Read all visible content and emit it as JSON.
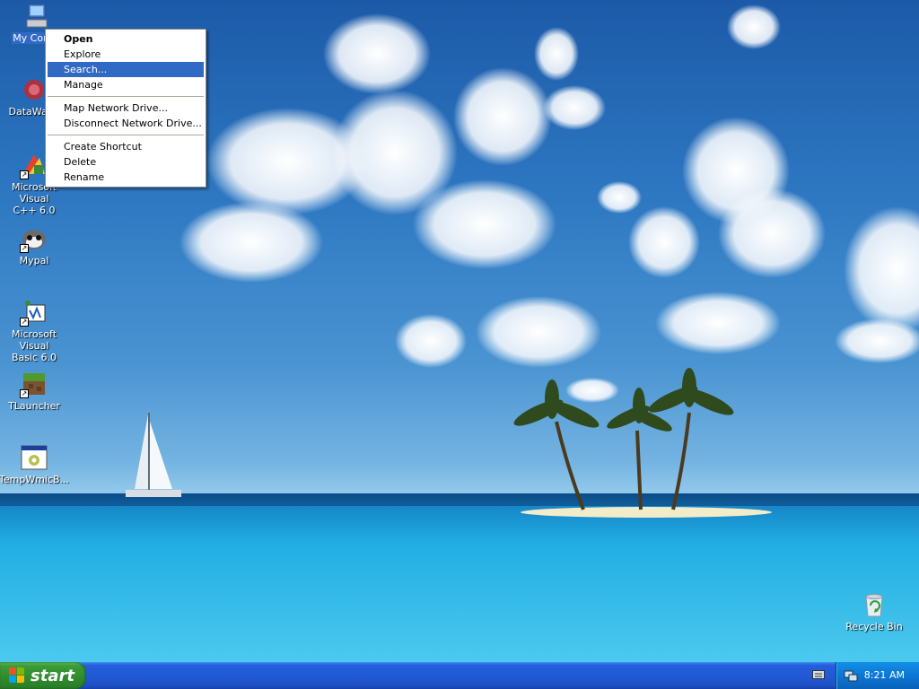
{
  "desktop": {
    "icons": [
      {
        "label": "My Computer",
        "label_visible": "My Comp",
        "icon": "my-computer-icon"
      },
      {
        "label": "DataWage",
        "icon": "datawage-icon"
      },
      {
        "label_line1": "Microsoft Visual",
        "label_line2": "C++ 6.0",
        "icon": "visual-cpp-icon"
      },
      {
        "label": "Mypal",
        "icon": "mypal-icon"
      },
      {
        "label_line1": "Microsoft Visual",
        "label_line2": "Basic 6.0",
        "icon": "visual-basic-icon"
      },
      {
        "label": "TLauncher",
        "icon": "tlauncher-icon"
      },
      {
        "label": "TempWmicB...",
        "icon": "tempwmic-icon"
      },
      {
        "label": "Recycle Bin",
        "icon": "recycle-bin-icon"
      }
    ]
  },
  "context_menu": {
    "items": [
      {
        "label": "Open"
      },
      {
        "label": "Explore"
      },
      {
        "label": "Search..."
      },
      {
        "label": "Manage"
      },
      {
        "label": "Map Network Drive..."
      },
      {
        "label": "Disconnect Network Drive..."
      },
      {
        "label": "Create Shortcut"
      },
      {
        "label": "Delete"
      },
      {
        "label": "Rename"
      }
    ]
  },
  "taskbar": {
    "start_label": "start",
    "clock": "8:21 AM"
  },
  "colors": {
    "selection": "#316ac5",
    "taskbar": "#245edb",
    "start_button": "#3c9a38"
  }
}
